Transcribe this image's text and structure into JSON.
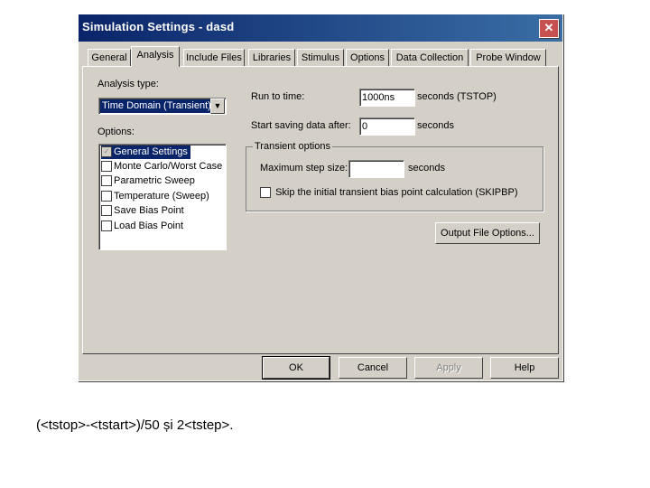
{
  "window": {
    "title": "Simulation Settings - dasd",
    "close_glyph": "✕"
  },
  "tabs": [
    {
      "label": "General"
    },
    {
      "label": "Analysis"
    },
    {
      "label": "Include Files"
    },
    {
      "label": "Libraries"
    },
    {
      "label": "Stimulus"
    },
    {
      "label": "Options"
    },
    {
      "label": "Data Collection"
    },
    {
      "label": "Probe Window"
    }
  ],
  "active_tab": "Analysis",
  "analysis": {
    "type_label": "Analysis type:",
    "type_value": "Time Domain (Transient)",
    "options_label": "Options:",
    "options": [
      {
        "label": "General Settings",
        "checked": true,
        "selected": true
      },
      {
        "label": "Monte Carlo/Worst Case",
        "checked": false
      },
      {
        "label": "Parametric Sweep",
        "checked": false
      },
      {
        "label": "Temperature (Sweep)",
        "checked": false
      },
      {
        "label": "Save Bias Point",
        "checked": false
      },
      {
        "label": "Load Bias Point",
        "checked": false
      }
    ],
    "run_to_time_label": "Run to time:",
    "run_to_time_value": "1000ns",
    "run_to_time_unit": "seconds  (TSTOP)",
    "start_saving_label": "Start saving data after:",
    "start_saving_value": "0",
    "start_saving_unit": "seconds",
    "transient_group_label": "Transient options",
    "max_step_label": "Maximum step size:",
    "max_step_value": "",
    "max_step_unit": "seconds",
    "skip_bias_label": "Skip the initial transient bias point calculation  (SKIPBP)",
    "output_file_button": "Output File Options..."
  },
  "buttons": {
    "ok": "OK",
    "cancel": "Cancel",
    "apply": "Apply",
    "help": "Help"
  },
  "caption": "(<tstop>-<tstart>)/50 și 2<tstep>."
}
